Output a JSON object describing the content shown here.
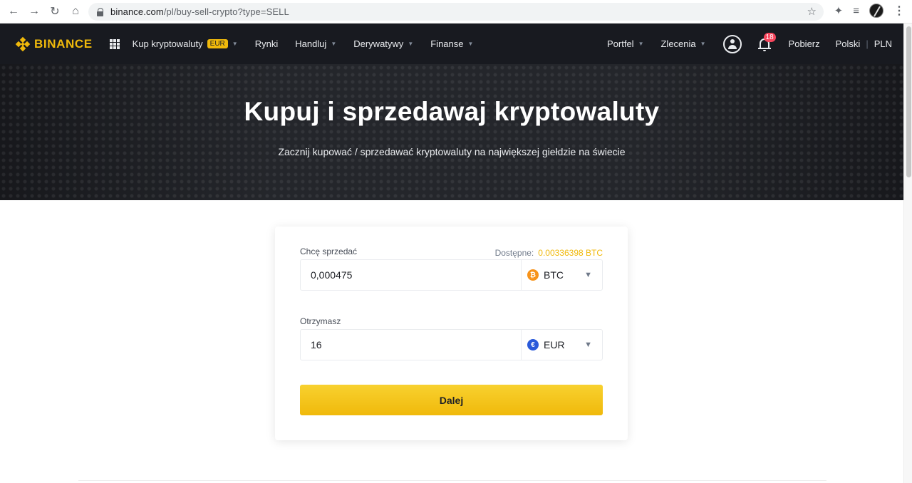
{
  "browser": {
    "url_host": "binance.com",
    "url_path": "/pl/buy-sell-crypto?type=SELL",
    "icons": [
      "back-icon",
      "forward-icon",
      "reload-icon",
      "home-icon",
      "lock-icon",
      "star-icon",
      "extensions-icon",
      "reading-list-icon",
      "profile-avatar",
      "menu-kebab-icon"
    ]
  },
  "header": {
    "logo_text": "BINANCE",
    "menu": [
      {
        "label": "Kup kryptowaluty",
        "badge": "EUR",
        "dropdown": true
      },
      {
        "label": "Rynki",
        "dropdown": false
      },
      {
        "label": "Handluj",
        "dropdown": true
      },
      {
        "label": "Derywatywy",
        "dropdown": true
      },
      {
        "label": "Finanse",
        "dropdown": true
      }
    ],
    "right": {
      "wallet": "Portfel",
      "orders": "Zlecenia",
      "notifications_count": "18",
      "download": "Pobierz",
      "language": "Polski",
      "currency": "PLN"
    },
    "accent_color": "#f0b90b",
    "background_color": "#181a20"
  },
  "hero": {
    "title": "Kupuj i sprzedawaj kryptowaluty",
    "subtitle": "Zacznij kupować / sprzedawać kryptowaluty na największej giełdzie na świecie"
  },
  "form": {
    "sell_label": "Chcę sprzedać",
    "available_label": "Dostępne:",
    "available_value": "0.00336398 BTC",
    "sell_amount": "0,000475",
    "sell_asset": "BTC",
    "receive_label": "Otrzymasz",
    "receive_amount": "16",
    "receive_asset": "EUR",
    "submit_label": "Dalej"
  }
}
